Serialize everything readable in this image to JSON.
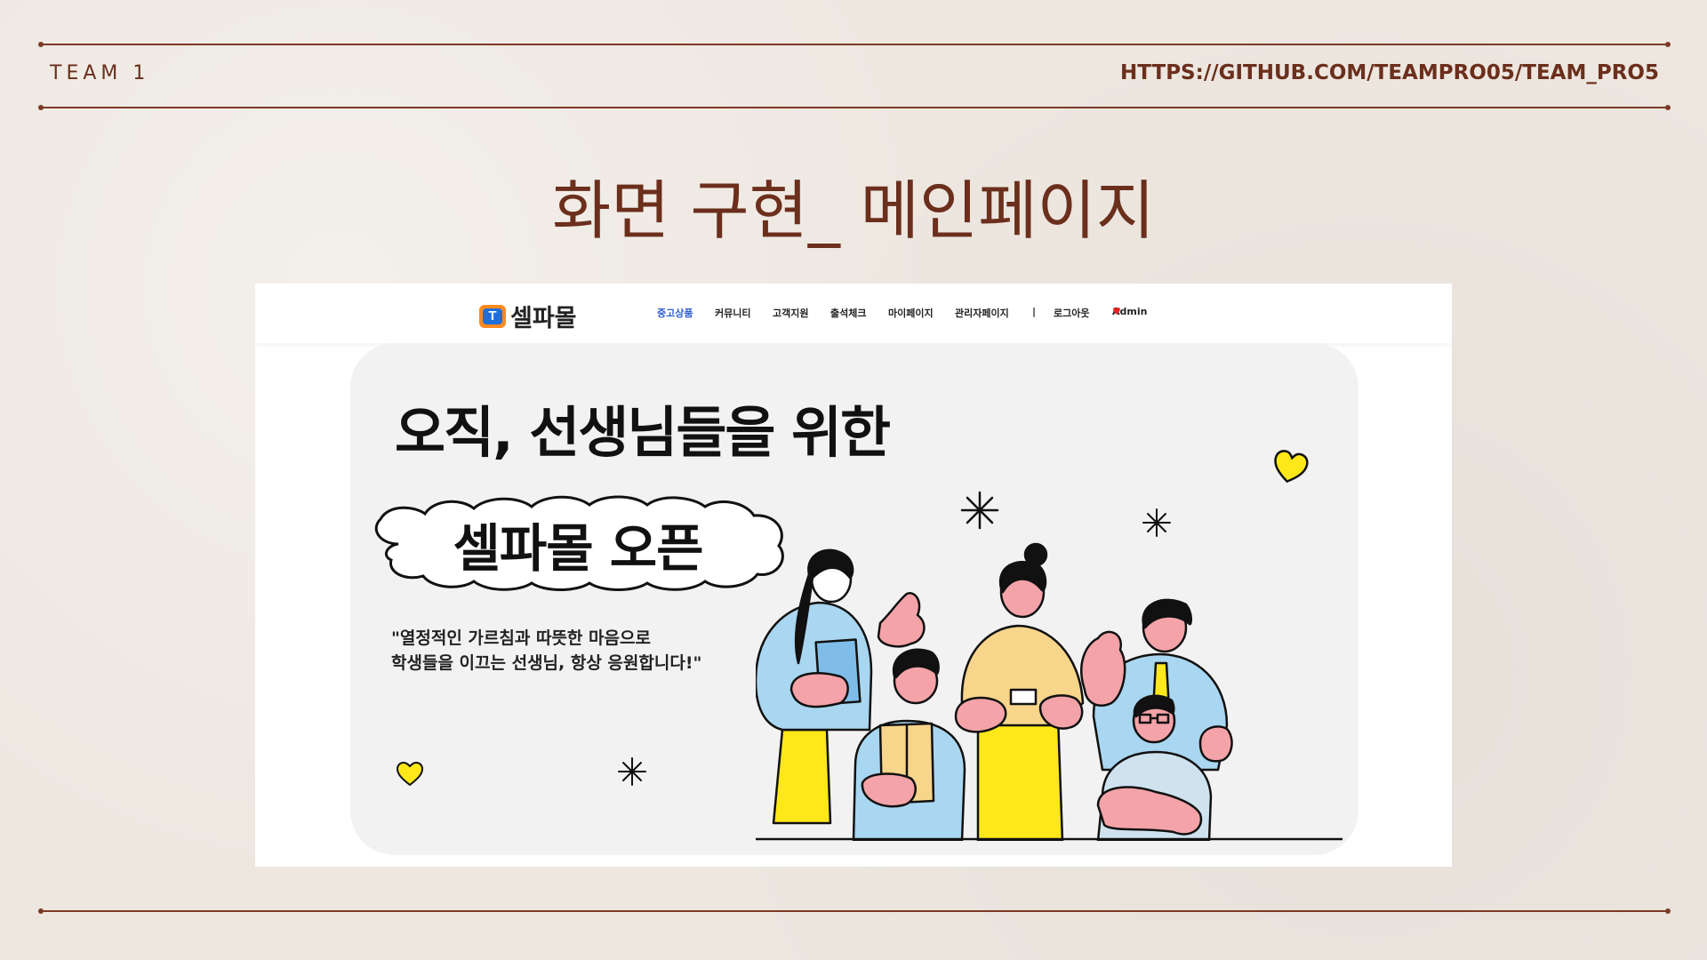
{
  "slide": {
    "team_label": "TEAM 1",
    "url": "HTTPS://GITHUB.COM/TEAMPRO05/TEAM_PRO5",
    "title": "화면 구현_ 메인페이지"
  },
  "site": {
    "logo_mark": "T",
    "logo_text": "셀파몰",
    "nav": [
      {
        "label": "중고상품",
        "active": true
      },
      {
        "label": "커뮤니티",
        "active": false
      },
      {
        "label": "고객지원",
        "active": false
      },
      {
        "label": "출석체크",
        "active": false
      },
      {
        "label": "마이페이지",
        "active": false
      },
      {
        "label": "관리자페이지",
        "active": false
      },
      {
        "label": "|",
        "active": false
      },
      {
        "label": "로그아웃",
        "active": false
      },
      {
        "label": "Admin",
        "active": false
      }
    ],
    "admin_heart": "♥",
    "hero": {
      "headline": "오직, 선생님들을 위한",
      "badge": "셀파몰 오픈",
      "quote_line1": "\"열정적인 가르침과 따뜻한 마음으로",
      "quote_line2": "학생들을 이끄는 선생님, 항상 응원합니다!\""
    }
  },
  "colors": {
    "brown": "#6b2f1c",
    "accent_blue": "#2f5fd0",
    "yellow": "#ffe81a",
    "skin": "#f4a3a8",
    "light_blue": "#a9d6f0"
  }
}
